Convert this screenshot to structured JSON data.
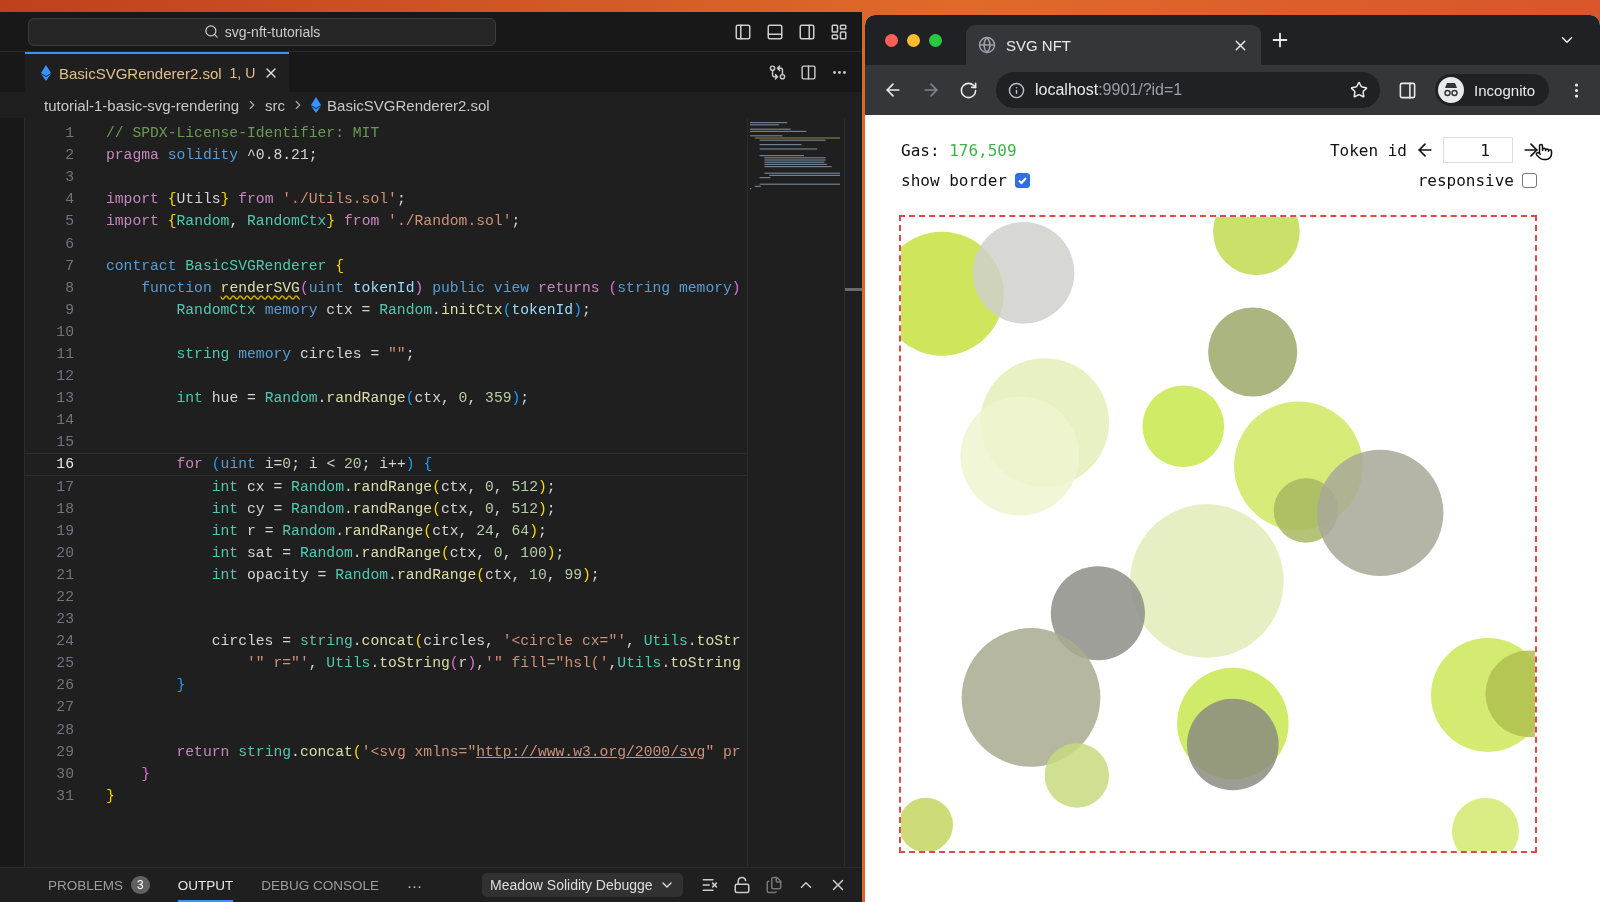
{
  "editor": {
    "search": "svg-nft-tutorials",
    "tab": {
      "filename": "BasicSVGRenderer2.sol",
      "badge": "1, U",
      "selected": true
    },
    "breadcrumbs": [
      "tutorial-1-basic-svg-rendering",
      "src",
      "BasicSVGRenderer2.sol"
    ],
    "lines": [
      {
        "number": "1",
        "selected": false,
        "tokens": [
          {
            "text": "// SPDX-License-Identifier: MIT",
            "kind": "c"
          }
        ]
      },
      {
        "number": "2",
        "selected": false,
        "tokens": [
          {
            "text": "pragma",
            "kind": "k"
          },
          {
            "text": " solidity",
            "kind": "s"
          },
          {
            "text": " ^0.8.21;",
            "kind": "p"
          }
        ]
      },
      {
        "number": "3",
        "selected": false
      },
      {
        "number": "4",
        "selected": false,
        "tokens": [
          {
            "text": "import ",
            "kind": "k"
          },
          {
            "text": "{",
            "kind": "b1"
          },
          {
            "text": "Utils",
            "kind": "p"
          },
          {
            "text": "}",
            "kind": "b1"
          },
          {
            "text": " from ",
            "kind": "k"
          },
          {
            "text": "'./Utils.sol'",
            "kind": "str"
          },
          {
            "text": ";",
            "kind": "p"
          }
        ]
      },
      {
        "number": "5",
        "selected": false,
        "tokens": [
          {
            "text": "import ",
            "kind": "k"
          },
          {
            "text": "{",
            "kind": "b1"
          },
          {
            "text": "Random",
            "kind": "t"
          },
          {
            "text": ", ",
            "kind": "p"
          },
          {
            "text": "RandomCtx",
            "kind": "t"
          },
          {
            "text": "}",
            "kind": "b1"
          },
          {
            "text": " from ",
            "kind": "k"
          },
          {
            "text": "'./Random.sol'",
            "kind": "str"
          },
          {
            "text": ";",
            "kind": "p"
          }
        ]
      },
      {
        "number": "6",
        "selected": false
      },
      {
        "number": "7",
        "selected": false,
        "tokens": [
          {
            "text": "contract",
            "kind": "s"
          },
          {
            "text": " BasicSVGRenderer ",
            "kind": "t"
          },
          {
            "text": "{",
            "kind": "b1"
          }
        ]
      },
      {
        "number": "8",
        "selected": false,
        "tokens": [
          {
            "text": "    function ",
            "kind": "s"
          },
          {
            "text": "renderSVG",
            "kind": "fw"
          },
          {
            "text": "(",
            "kind": "b2"
          },
          {
            "text": "uint",
            "kind": "s"
          },
          {
            "text": " tokenId",
            "kind": "v"
          },
          {
            "text": ")",
            "kind": "b2"
          },
          {
            "text": " public view ",
            "kind": "s"
          },
          {
            "text": "returns ",
            "kind": "k"
          },
          {
            "text": "(",
            "kind": "b2"
          },
          {
            "text": "string memory",
            "kind": "s"
          },
          {
            "text": ")",
            "kind": "b2"
          }
        ]
      },
      {
        "number": "9",
        "selected": false,
        "tokens": [
          {
            "text": "        RandomCtx",
            "kind": "t"
          },
          {
            "text": " memory",
            "kind": "s"
          },
          {
            "text": " ctx = ",
            "kind": "p"
          },
          {
            "text": "Random",
            "kind": "t"
          },
          {
            "text": ".",
            "kind": "p"
          },
          {
            "text": "initCtx",
            "kind": "f"
          },
          {
            "text": "(",
            "kind": "b3"
          },
          {
            "text": "tokenId",
            "kind": "v"
          },
          {
            "text": ")",
            "kind": "b3"
          },
          {
            "text": ";",
            "kind": "p"
          }
        ]
      },
      {
        "number": "10",
        "selected": false
      },
      {
        "number": "11",
        "selected": false,
        "tokens": [
          {
            "text": "        string",
            "kind": "t"
          },
          {
            "text": " memory",
            "kind": "s"
          },
          {
            "text": " circles = ",
            "kind": "p"
          },
          {
            "text": "\"\"",
            "kind": "str"
          },
          {
            "text": ";",
            "kind": "p"
          }
        ]
      },
      {
        "number": "12",
        "selected": false
      },
      {
        "number": "13",
        "selected": false,
        "tokens": [
          {
            "text": "        int",
            "kind": "t"
          },
          {
            "text": " hue = ",
            "kind": "p"
          },
          {
            "text": "Random",
            "kind": "t"
          },
          {
            "text": ".",
            "kind": "p"
          },
          {
            "text": "randRange",
            "kind": "f"
          },
          {
            "text": "(",
            "kind": "b3"
          },
          {
            "text": "ctx, ",
            "kind": "p"
          },
          {
            "text": "0",
            "kind": "n"
          },
          {
            "text": ", ",
            "kind": "p"
          },
          {
            "text": "359",
            "kind": "n"
          },
          {
            "text": ")",
            "kind": "b3"
          },
          {
            "text": ";",
            "kind": "p"
          }
        ]
      },
      {
        "number": "14",
        "selected": false
      },
      {
        "number": "15",
        "selected": false
      },
      {
        "number": "16",
        "selected": true,
        "tokens": [
          {
            "text": "        for ",
            "kind": "k"
          },
          {
            "text": "(",
            "kind": "b3"
          },
          {
            "text": "uint",
            "kind": "s"
          },
          {
            "text": " i=",
            "kind": "p"
          },
          {
            "text": "0",
            "kind": "n"
          },
          {
            "text": "; i < ",
            "kind": "p"
          },
          {
            "text": "20",
            "kind": "n"
          },
          {
            "text": "; i++",
            "kind": "p"
          },
          {
            "text": ")",
            "kind": "b3"
          },
          {
            "text": " {",
            "kind": "b3"
          }
        ]
      },
      {
        "number": "17",
        "selected": false,
        "tokens": [
          {
            "text": "            int",
            "kind": "t"
          },
          {
            "text": " cx = ",
            "kind": "p"
          },
          {
            "text": "Random",
            "kind": "t"
          },
          {
            "text": ".",
            "kind": "p"
          },
          {
            "text": "randRange",
            "kind": "f"
          },
          {
            "text": "(",
            "kind": "b1"
          },
          {
            "text": "ctx, ",
            "kind": "p"
          },
          {
            "text": "0",
            "kind": "n"
          },
          {
            "text": ", ",
            "kind": "p"
          },
          {
            "text": "512",
            "kind": "n"
          },
          {
            "text": ")",
            "kind": "b1"
          },
          {
            "text": ";",
            "kind": "p"
          }
        ]
      },
      {
        "number": "18",
        "selected": false,
        "tokens": [
          {
            "text": "            int",
            "kind": "t"
          },
          {
            "text": " cy = ",
            "kind": "p"
          },
          {
            "text": "Random",
            "kind": "t"
          },
          {
            "text": ".",
            "kind": "p"
          },
          {
            "text": "randRange",
            "kind": "f"
          },
          {
            "text": "(",
            "kind": "b1"
          },
          {
            "text": "ctx, ",
            "kind": "p"
          },
          {
            "text": "0",
            "kind": "n"
          },
          {
            "text": ", ",
            "kind": "p"
          },
          {
            "text": "512",
            "kind": "n"
          },
          {
            "text": ")",
            "kind": "b1"
          },
          {
            "text": ";",
            "kind": "p"
          }
        ]
      },
      {
        "number": "19",
        "selected": false,
        "tokens": [
          {
            "text": "            int",
            "kind": "t"
          },
          {
            "text": " r = ",
            "kind": "p"
          },
          {
            "text": "Random",
            "kind": "t"
          },
          {
            "text": ".",
            "kind": "p"
          },
          {
            "text": "randRange",
            "kind": "f"
          },
          {
            "text": "(",
            "kind": "b1"
          },
          {
            "text": "ctx, ",
            "kind": "p"
          },
          {
            "text": "24",
            "kind": "n"
          },
          {
            "text": ", ",
            "kind": "p"
          },
          {
            "text": "64",
            "kind": "n"
          },
          {
            "text": ")",
            "kind": "b1"
          },
          {
            "text": ";",
            "kind": "p"
          }
        ]
      },
      {
        "number": "20",
        "selected": false,
        "tokens": [
          {
            "text": "            int",
            "kind": "t"
          },
          {
            "text": " sat = ",
            "kind": "p"
          },
          {
            "text": "Random",
            "kind": "t"
          },
          {
            "text": ".",
            "kind": "p"
          },
          {
            "text": "randRange",
            "kind": "f"
          },
          {
            "text": "(",
            "kind": "b1"
          },
          {
            "text": "ctx, ",
            "kind": "p"
          },
          {
            "text": "0",
            "kind": "n"
          },
          {
            "text": ", ",
            "kind": "p"
          },
          {
            "text": "100",
            "kind": "n"
          },
          {
            "text": ")",
            "kind": "b1"
          },
          {
            "text": ";",
            "kind": "p"
          }
        ]
      },
      {
        "number": "21",
        "selected": false,
        "tokens": [
          {
            "text": "            int",
            "kind": "t"
          },
          {
            "text": " opacity = ",
            "kind": "p"
          },
          {
            "text": "Random",
            "kind": "t"
          },
          {
            "text": ".",
            "kind": "p"
          },
          {
            "text": "randRange",
            "kind": "f"
          },
          {
            "text": "(",
            "kind": "b1"
          },
          {
            "text": "ctx, ",
            "kind": "p"
          },
          {
            "text": "10",
            "kind": "n"
          },
          {
            "text": ", ",
            "kind": "p"
          },
          {
            "text": "99",
            "kind": "n"
          },
          {
            "text": ")",
            "kind": "b1"
          },
          {
            "text": ";",
            "kind": "p"
          }
        ]
      },
      {
        "number": "22",
        "selected": false
      },
      {
        "number": "23",
        "selected": false
      },
      {
        "number": "24",
        "selected": false,
        "tokens": [
          {
            "text": "            circles = ",
            "kind": "p"
          },
          {
            "text": "string",
            "kind": "t"
          },
          {
            "text": ".",
            "kind": "p"
          },
          {
            "text": "concat",
            "kind": "f"
          },
          {
            "text": "(",
            "kind": "b1"
          },
          {
            "text": "circles, ",
            "kind": "p"
          },
          {
            "text": "'<circle cx=\"'",
            "kind": "str"
          },
          {
            "text": ", ",
            "kind": "p"
          },
          {
            "text": "Utils",
            "kind": "t"
          },
          {
            "text": ".",
            "kind": "p"
          },
          {
            "text": "toStr",
            "kind": "f"
          }
        ]
      },
      {
        "number": "25",
        "selected": false,
        "tokens": [
          {
            "text": "                '\" r=\"'",
            "kind": "str"
          },
          {
            "text": ", ",
            "kind": "p"
          },
          {
            "text": "Utils",
            "kind": "t"
          },
          {
            "text": ".",
            "kind": "p"
          },
          {
            "text": "toString",
            "kind": "f"
          },
          {
            "text": "(",
            "kind": "b2"
          },
          {
            "text": "r",
            "kind": "p"
          },
          {
            "text": ")",
            "kind": "b2"
          },
          {
            "text": ",",
            "kind": "p"
          },
          {
            "text": "'\" fill=\"hsl('",
            "kind": "str"
          },
          {
            "text": ",",
            "kind": "p"
          },
          {
            "text": "Utils",
            "kind": "t"
          },
          {
            "text": ".",
            "kind": "p"
          },
          {
            "text": "toString",
            "kind": "f"
          }
        ]
      },
      {
        "number": "26",
        "selected": false,
        "tokens": [
          {
            "text": "        }",
            "kind": "b3"
          }
        ]
      },
      {
        "number": "27",
        "selected": false
      },
      {
        "number": "28",
        "selected": false
      },
      {
        "number": "29",
        "selected": false,
        "tokens": [
          {
            "text": "        return ",
            "kind": "k"
          },
          {
            "text": "string",
            "kind": "t"
          },
          {
            "text": ".",
            "kind": "p"
          },
          {
            "text": "concat",
            "kind": "f"
          },
          {
            "text": "(",
            "kind": "b1"
          },
          {
            "text": "'<svg xmlns=\"",
            "kind": "str"
          },
          {
            "text": "http://www.w3.org/2000/svg",
            "kind": "url"
          },
          {
            "text": "\" pr",
            "kind": "str"
          }
        ]
      },
      {
        "number": "30",
        "selected": false,
        "tokens": [
          {
            "text": "    }",
            "kind": "b2"
          }
        ]
      },
      {
        "number": "31",
        "selected": false,
        "tokens": [
          {
            "text": "}",
            "kind": "b1"
          }
        ]
      }
    ]
  },
  "panel": {
    "tabs": [
      {
        "label": "PROBLEMS",
        "badge": "3",
        "selected": false
      },
      {
        "label": "OUTPUT",
        "selected": true
      },
      {
        "label": "DEBUG CONSOLE",
        "selected": false
      }
    ],
    "more": "···",
    "dropdown": "Meadow Solidity Debugge"
  },
  "browser": {
    "tab_title": "SVG NFT",
    "url_host": "localhost",
    "url_rest": ":9901/?id=1",
    "profile": "Incognito"
  },
  "page": {
    "gas_label": "Gas:",
    "gas_value": "176,509",
    "token_label": "Token id",
    "token_value": "1",
    "show_border": {
      "label": "show border",
      "checked": true
    },
    "responsive": {
      "label": "responsive",
      "checked": false
    }
  }
}
